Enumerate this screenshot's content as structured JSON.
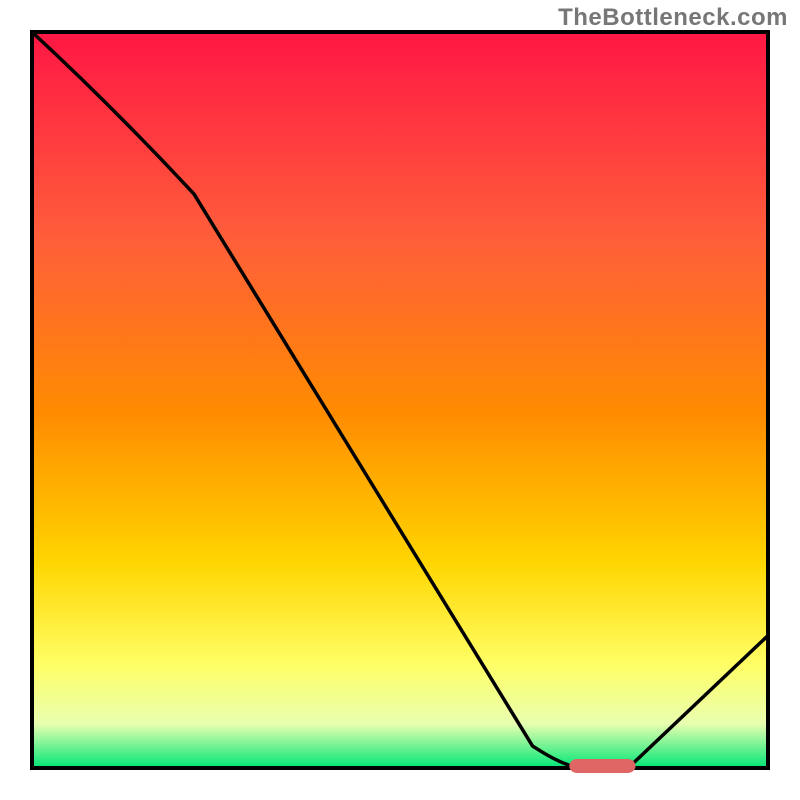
{
  "watermark": "TheBottleneck.com",
  "chart_data": {
    "type": "line",
    "title": "",
    "xlabel": "",
    "ylabel": "",
    "xlim": [
      0,
      100
    ],
    "ylim": [
      0,
      100
    ],
    "grid": false,
    "legend": false,
    "background_gradient": {
      "top": "#ff1744",
      "mid_upper": "#ff8c00",
      "mid": "#ffd500",
      "mid_lower": "#ffff66",
      "near_bottom": "#e8ffb0",
      "bottom": "#00e676"
    },
    "series": [
      {
        "name": "curve",
        "color": "#000000",
        "x": [
          0,
          22,
          68,
          75,
          81,
          100
        ],
        "y": [
          100,
          78,
          3,
          0,
          0,
          18
        ]
      }
    ],
    "marker": {
      "name": "optimal-range",
      "color": "#e06666",
      "x_start": 73,
      "x_end": 82,
      "y": 0,
      "thickness": 2
    },
    "axes_visible": false,
    "plot_border": true
  }
}
